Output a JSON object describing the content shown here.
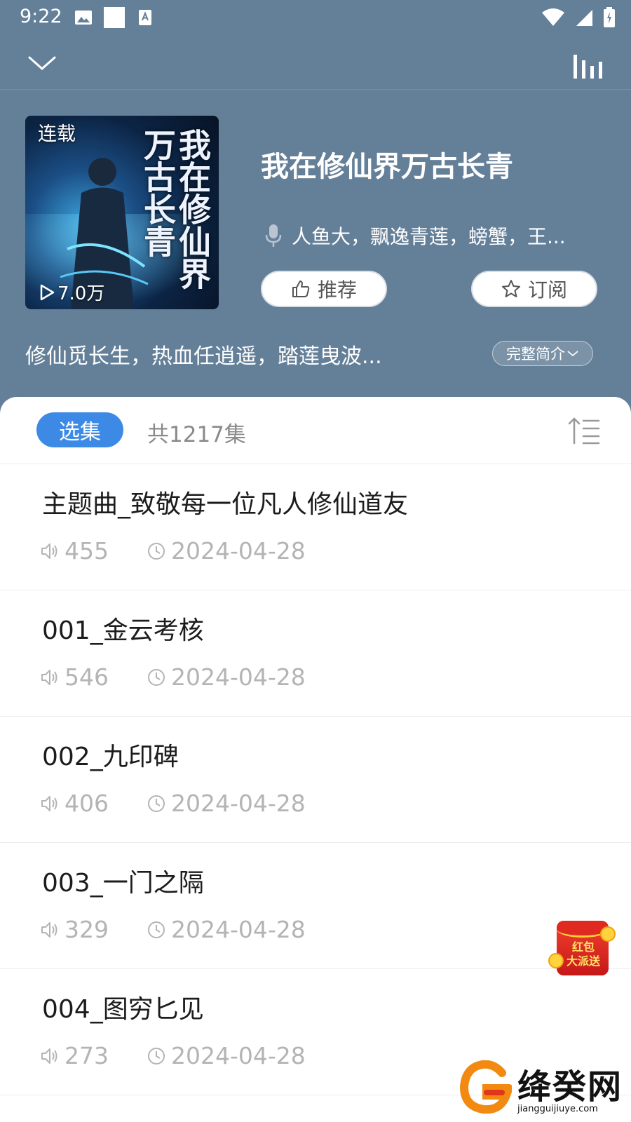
{
  "status_bar": {
    "time": "9:22"
  },
  "book": {
    "status_badge": "连载",
    "play_count": "7.0万",
    "title": "我在修仙界万古长青",
    "cover_title": "我在修仙界万古长青",
    "narrators": "人鱼大，飘逸青莲，螃蟹，王...",
    "intro": "修仙觅长生，热血任逍遥，踏莲曳波...",
    "full_intro_label": "完整简介"
  },
  "actions": {
    "recommend_label": "推荐",
    "subscribe_label": "订阅"
  },
  "episodes_header": {
    "tab_label": "选集",
    "count_label": "共1217集"
  },
  "episodes": [
    {
      "title": "主题曲_致敬每一位凡人修仙道友",
      "plays": "455",
      "date": "2024-04-28"
    },
    {
      "title": "001_金云考核",
      "plays": "546",
      "date": "2024-04-28"
    },
    {
      "title": "002_九印碑",
      "plays": "406",
      "date": "2024-04-28"
    },
    {
      "title": "003_一门之隔",
      "plays": "329",
      "date": "2024-04-28"
    },
    {
      "title": "004_图穷匕见",
      "plays": "273",
      "date": "2024-04-28"
    }
  ],
  "red_packet": {
    "text_line1": "红包",
    "text_line2": "大派送"
  },
  "watermark": {
    "text": "绛癸网",
    "sub": "jiangguijiuye.com"
  },
  "colors": {
    "header_bg": "#647f98",
    "accent": "#3d8ae6",
    "meta_text": "#b4b4b4"
  },
  "icons": [
    "chevron-down-icon",
    "equalizer-icon",
    "mic-icon",
    "thumbs-up-icon",
    "star-icon",
    "sort-icon",
    "speaker-icon",
    "clock-icon",
    "play-icon"
  ]
}
